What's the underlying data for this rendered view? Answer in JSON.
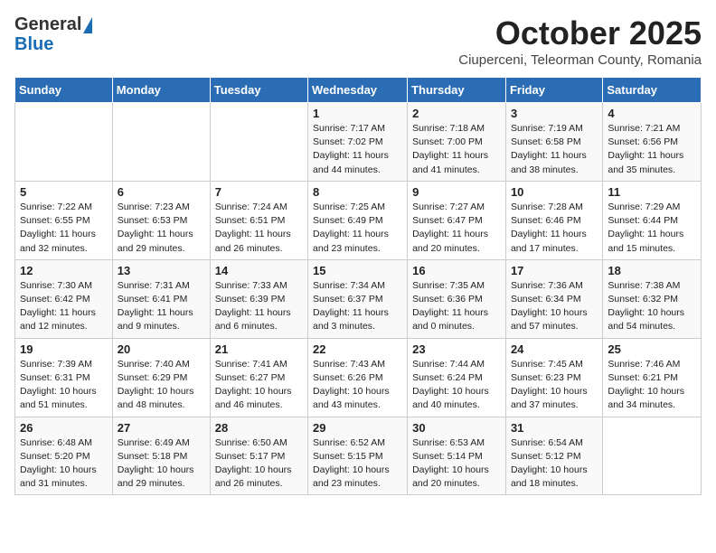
{
  "header": {
    "logo_line1": "General",
    "logo_line2": "Blue",
    "month": "October 2025",
    "location": "Ciuperceni, Teleorman County, Romania"
  },
  "days_of_week": [
    "Sunday",
    "Monday",
    "Tuesday",
    "Wednesday",
    "Thursday",
    "Friday",
    "Saturday"
  ],
  "weeks": [
    [
      {
        "day": "",
        "info": ""
      },
      {
        "day": "",
        "info": ""
      },
      {
        "day": "",
        "info": ""
      },
      {
        "day": "1",
        "info": "Sunrise: 7:17 AM\nSunset: 7:02 PM\nDaylight: 11 hours and 44 minutes."
      },
      {
        "day": "2",
        "info": "Sunrise: 7:18 AM\nSunset: 7:00 PM\nDaylight: 11 hours and 41 minutes."
      },
      {
        "day": "3",
        "info": "Sunrise: 7:19 AM\nSunset: 6:58 PM\nDaylight: 11 hours and 38 minutes."
      },
      {
        "day": "4",
        "info": "Sunrise: 7:21 AM\nSunset: 6:56 PM\nDaylight: 11 hours and 35 minutes."
      }
    ],
    [
      {
        "day": "5",
        "info": "Sunrise: 7:22 AM\nSunset: 6:55 PM\nDaylight: 11 hours and 32 minutes."
      },
      {
        "day": "6",
        "info": "Sunrise: 7:23 AM\nSunset: 6:53 PM\nDaylight: 11 hours and 29 minutes."
      },
      {
        "day": "7",
        "info": "Sunrise: 7:24 AM\nSunset: 6:51 PM\nDaylight: 11 hours and 26 minutes."
      },
      {
        "day": "8",
        "info": "Sunrise: 7:25 AM\nSunset: 6:49 PM\nDaylight: 11 hours and 23 minutes."
      },
      {
        "day": "9",
        "info": "Sunrise: 7:27 AM\nSunset: 6:47 PM\nDaylight: 11 hours and 20 minutes."
      },
      {
        "day": "10",
        "info": "Sunrise: 7:28 AM\nSunset: 6:46 PM\nDaylight: 11 hours and 17 minutes."
      },
      {
        "day": "11",
        "info": "Sunrise: 7:29 AM\nSunset: 6:44 PM\nDaylight: 11 hours and 15 minutes."
      }
    ],
    [
      {
        "day": "12",
        "info": "Sunrise: 7:30 AM\nSunset: 6:42 PM\nDaylight: 11 hours and 12 minutes."
      },
      {
        "day": "13",
        "info": "Sunrise: 7:31 AM\nSunset: 6:41 PM\nDaylight: 11 hours and 9 minutes."
      },
      {
        "day": "14",
        "info": "Sunrise: 7:33 AM\nSunset: 6:39 PM\nDaylight: 11 hours and 6 minutes."
      },
      {
        "day": "15",
        "info": "Sunrise: 7:34 AM\nSunset: 6:37 PM\nDaylight: 11 hours and 3 minutes."
      },
      {
        "day": "16",
        "info": "Sunrise: 7:35 AM\nSunset: 6:36 PM\nDaylight: 11 hours and 0 minutes."
      },
      {
        "day": "17",
        "info": "Sunrise: 7:36 AM\nSunset: 6:34 PM\nDaylight: 10 hours and 57 minutes."
      },
      {
        "day": "18",
        "info": "Sunrise: 7:38 AM\nSunset: 6:32 PM\nDaylight: 10 hours and 54 minutes."
      }
    ],
    [
      {
        "day": "19",
        "info": "Sunrise: 7:39 AM\nSunset: 6:31 PM\nDaylight: 10 hours and 51 minutes."
      },
      {
        "day": "20",
        "info": "Sunrise: 7:40 AM\nSunset: 6:29 PM\nDaylight: 10 hours and 48 minutes."
      },
      {
        "day": "21",
        "info": "Sunrise: 7:41 AM\nSunset: 6:27 PM\nDaylight: 10 hours and 46 minutes."
      },
      {
        "day": "22",
        "info": "Sunrise: 7:43 AM\nSunset: 6:26 PM\nDaylight: 10 hours and 43 minutes."
      },
      {
        "day": "23",
        "info": "Sunrise: 7:44 AM\nSunset: 6:24 PM\nDaylight: 10 hours and 40 minutes."
      },
      {
        "day": "24",
        "info": "Sunrise: 7:45 AM\nSunset: 6:23 PM\nDaylight: 10 hours and 37 minutes."
      },
      {
        "day": "25",
        "info": "Sunrise: 7:46 AM\nSunset: 6:21 PM\nDaylight: 10 hours and 34 minutes."
      }
    ],
    [
      {
        "day": "26",
        "info": "Sunrise: 6:48 AM\nSunset: 5:20 PM\nDaylight: 10 hours and 31 minutes."
      },
      {
        "day": "27",
        "info": "Sunrise: 6:49 AM\nSunset: 5:18 PM\nDaylight: 10 hours and 29 minutes."
      },
      {
        "day": "28",
        "info": "Sunrise: 6:50 AM\nSunset: 5:17 PM\nDaylight: 10 hours and 26 minutes."
      },
      {
        "day": "29",
        "info": "Sunrise: 6:52 AM\nSunset: 5:15 PM\nDaylight: 10 hours and 23 minutes."
      },
      {
        "day": "30",
        "info": "Sunrise: 6:53 AM\nSunset: 5:14 PM\nDaylight: 10 hours and 20 minutes."
      },
      {
        "day": "31",
        "info": "Sunrise: 6:54 AM\nSunset: 5:12 PM\nDaylight: 10 hours and 18 minutes."
      },
      {
        "day": "",
        "info": ""
      }
    ]
  ]
}
